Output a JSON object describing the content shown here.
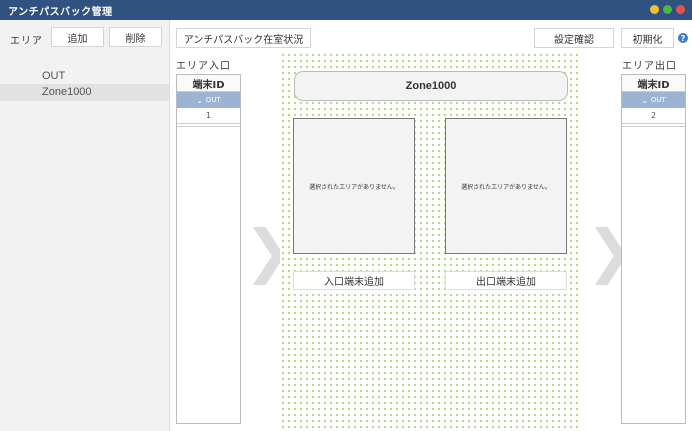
{
  "window": {
    "title": "アンチパスバック管理",
    "controls": [
      "minimize",
      "maximize",
      "close"
    ]
  },
  "sidebar": {
    "label": "エリア",
    "add_label": "追加",
    "delete_label": "削除",
    "items": [
      {
        "label": "OUT",
        "selected": false
      },
      {
        "label": "Zone1000",
        "selected": true
      }
    ]
  },
  "toolbar": {
    "status_label": "アンチパスバック在室状況",
    "confirm_label": "設定確認",
    "init_label": "初期化",
    "help_glyph": "?"
  },
  "entry": {
    "label": "エリア入口",
    "table": {
      "header": "端末ID",
      "group": "OUT",
      "rows": [
        "1"
      ]
    }
  },
  "exit": {
    "label": "エリア出口",
    "table": {
      "header": "端末ID",
      "group": "OUT",
      "rows": [
        "2"
      ]
    }
  },
  "zone": {
    "title": "Zone1000",
    "entry_empty": "選択されたエリアがありません。",
    "exit_empty": "選択されたエリアがありません。",
    "add_entry_label": "入口端末追加",
    "add_exit_label": "出口端末追加"
  },
  "colors": {
    "titlebar": "#2f5280",
    "group_row": "#9bb4d4",
    "dots": "#b9d98e",
    "selected_item": "#e2e2e2"
  },
  "icons": {
    "minimize": "minimize-icon",
    "maximize": "maximize-icon",
    "close": "close-icon",
    "help": "help-icon",
    "group_toggle": "chevron-down-icon",
    "flow_arrow": "chevron-right-icon"
  }
}
